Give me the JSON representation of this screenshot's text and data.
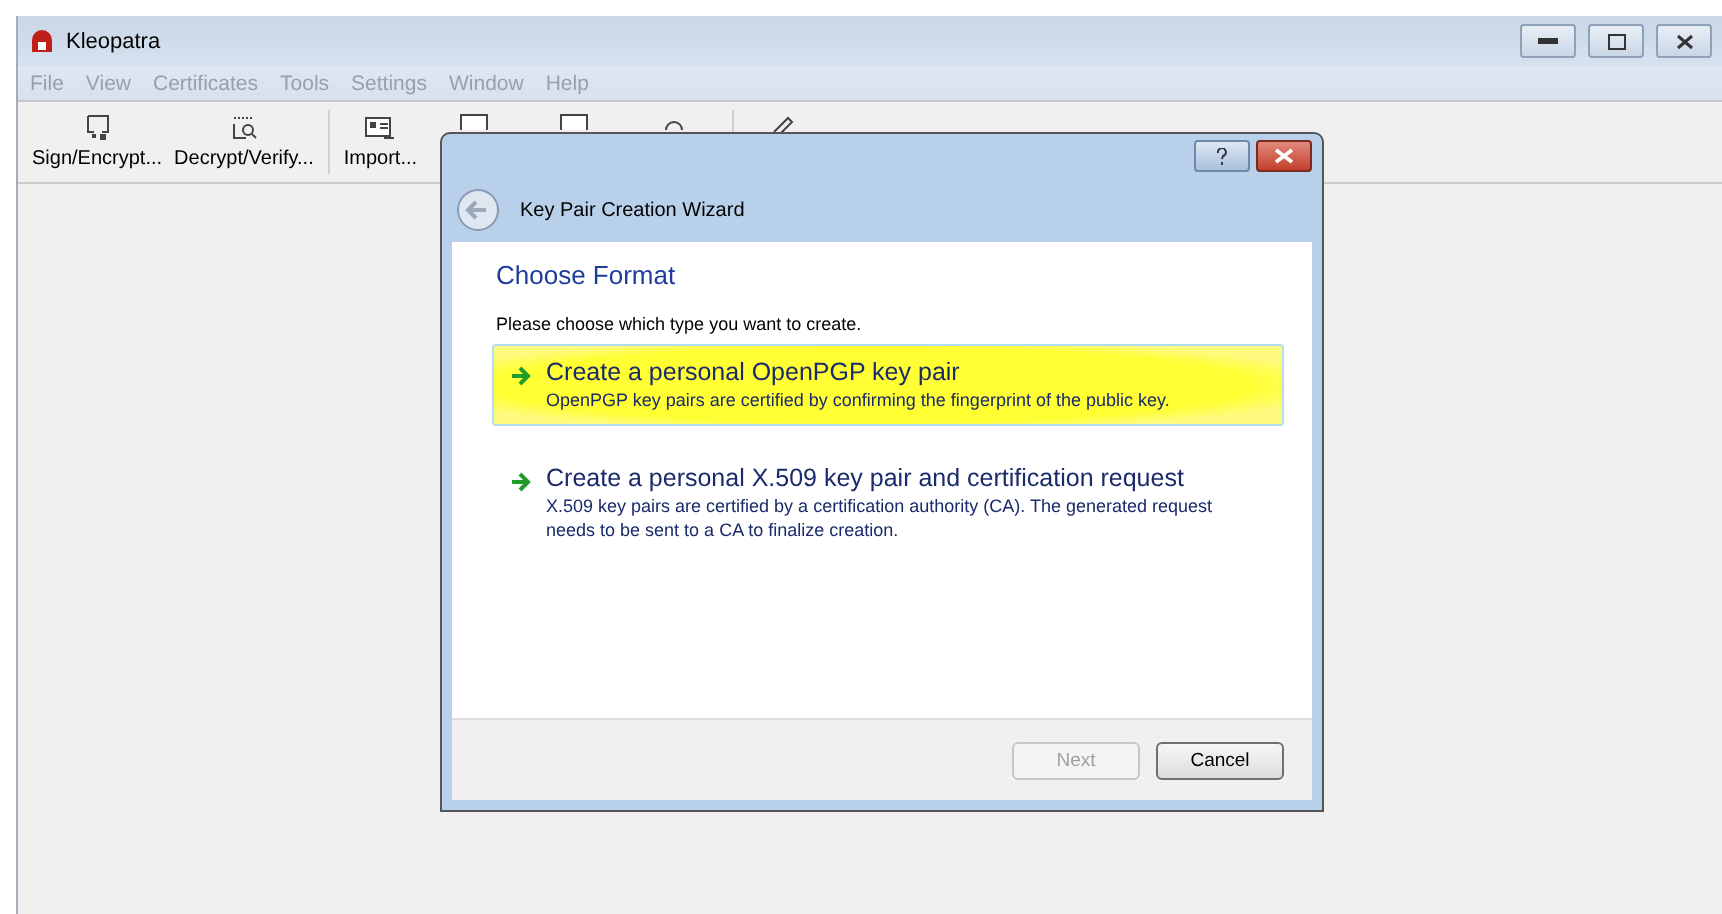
{
  "window": {
    "title": "Kleopatra"
  },
  "menu": [
    {
      "label": "File",
      "disabled": true
    },
    {
      "label": "View",
      "disabled": true
    },
    {
      "label": "Certificates",
      "disabled": true
    },
    {
      "label": "Tools",
      "disabled": true
    },
    {
      "label": "Settings",
      "disabled": true
    },
    {
      "label": "Window",
      "disabled": true
    },
    {
      "label": "Help",
      "disabled": true
    }
  ],
  "toolbar": [
    {
      "kind": "sign",
      "label": "Sign/Encrypt..."
    },
    {
      "kind": "decrypt",
      "label": "Decrypt/Verify..."
    },
    {
      "kind": "import",
      "label": "Import..."
    }
  ],
  "dialog": {
    "title": "Key Pair Creation Wizard",
    "heading": "Choose Format",
    "prompt": "Please choose which type you want to create.",
    "options": [
      {
        "title": "Create a personal OpenPGP key pair",
        "description": "OpenPGP key pairs are certified by confirming the fingerprint of the public key.",
        "selected": true
      },
      {
        "title": "Create a personal X.509 key pair and certification request",
        "description": "X.509 key pairs are certified by a certification authority (CA). The generated request needs to be sent to a CA to finalize creation.",
        "selected": false
      }
    ],
    "buttons": [
      {
        "label": "Next",
        "disabled": true
      },
      {
        "label": "Cancel",
        "disabled": false
      }
    ]
  }
}
